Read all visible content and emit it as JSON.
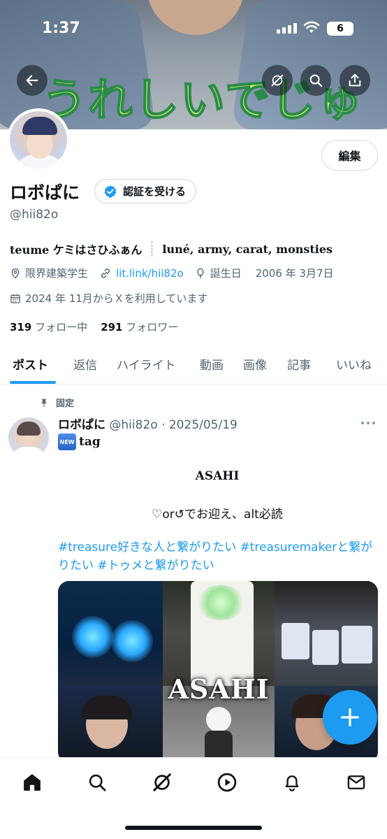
{
  "status_bar": {
    "time": "1:37",
    "battery": "6"
  },
  "banner": {
    "caption": "うれしいでじゅ"
  },
  "profile": {
    "edit_label": "編集",
    "name": "ロボぱに",
    "verify_label": "認証を受ける",
    "handle": "@hii82o",
    "bio_left": "teume ケミはさひふぁん",
    "bio_right": "luné, army, carat, monsties",
    "location": "限界建築学生",
    "link": "lit.link/hii82o",
    "birthday_label": "誕生日",
    "birthday": "2006 年 3月7日",
    "joined": "2024 年 11月からＸを利用しています",
    "following_count": "319",
    "following_label": "フォロー中",
    "followers_count": "291",
    "followers_label": "フォロワー"
  },
  "tabs": [
    "ポスト",
    "返信",
    "ハイライト",
    "動画",
    "画像",
    "記事",
    "いいね"
  ],
  "post": {
    "pinned_label": "固定",
    "author": "ロボぱに",
    "handle_date": "@hii82o · 2025/05/19",
    "new_badge": "NEW",
    "line1": "tag",
    "line2": "ASAHI",
    "line3": "♡or↺でお迎え、alt必読",
    "hashtags": "#treasure好きな人と繋がりたい  #treasuremakerと繋がりたい  #トゥメと繋がりたい",
    "media_title": "ASAHI"
  },
  "colors": {
    "accent": "#1d9bf0",
    "text": "#0f1419",
    "muted": "#536471"
  },
  "bottom_nav": [
    "home-icon",
    "search-icon",
    "grok-icon",
    "video-icon",
    "notifications-icon",
    "messages-icon"
  ]
}
